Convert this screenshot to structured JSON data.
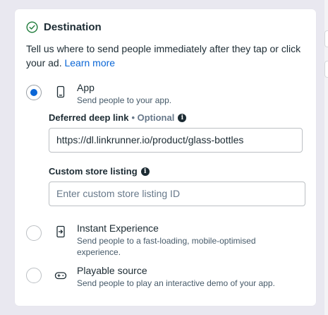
{
  "section": {
    "title": "Destination",
    "description": "Tell us where to send people immediately after they tap or click your ad.",
    "learn_more": "Learn more"
  },
  "options": [
    {
      "title": "App",
      "subtitle": "Send people to your app.",
      "selected": true,
      "icon": "mobile-phone-icon"
    },
    {
      "title": "Instant Experience",
      "subtitle": "Send people to a fast-loading, mobile-optimised experience.",
      "selected": false,
      "icon": "instant-experience-icon"
    },
    {
      "title": "Playable source",
      "subtitle": "Send people to play an interactive demo of your app.",
      "selected": false,
      "icon": "gamepad-icon"
    }
  ],
  "deferred_deep_link": {
    "label": "Deferred deep link",
    "optional": "• Optional",
    "value": "https://dl.linkrunner.io/product/glass-bottles"
  },
  "custom_store_listing": {
    "label": "Custom store listing",
    "placeholder": "Enter custom store listing ID"
  },
  "colors": {
    "accent": "#0a66d6",
    "text": "#1c2b33",
    "muted": "#465a69"
  }
}
